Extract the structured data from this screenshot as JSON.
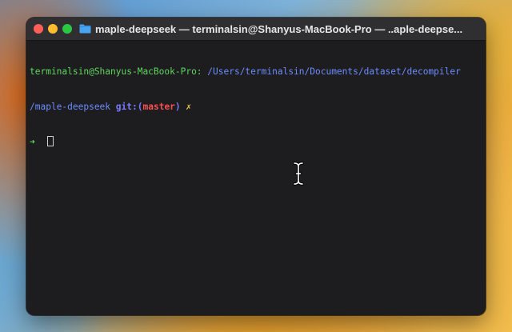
{
  "window": {
    "title": "maple-deepseek — terminalsin@Shanyus-MacBook-Pro — ..aple-deepse..."
  },
  "terminal": {
    "prompt_user_host": "terminalsin@Shanyus-MacBook-Pro:",
    "path_part1": " /Users/terminalsin/Documents/dataset/decompiler",
    "path_part2": "/maple-deepseek",
    "git_label": "git:",
    "paren_open": "(",
    "branch": "master",
    "paren_close": ")",
    "dirty_mark": "✗",
    "arrow": "➜"
  },
  "colors": {
    "user_host": "#5fd75f",
    "path": "#6c8cff",
    "branch": "#ff4f4f",
    "dirty": "#e8c547"
  },
  "icons": {
    "title": "folder-icon",
    "pointer": "ibeam-cursor-icon"
  }
}
